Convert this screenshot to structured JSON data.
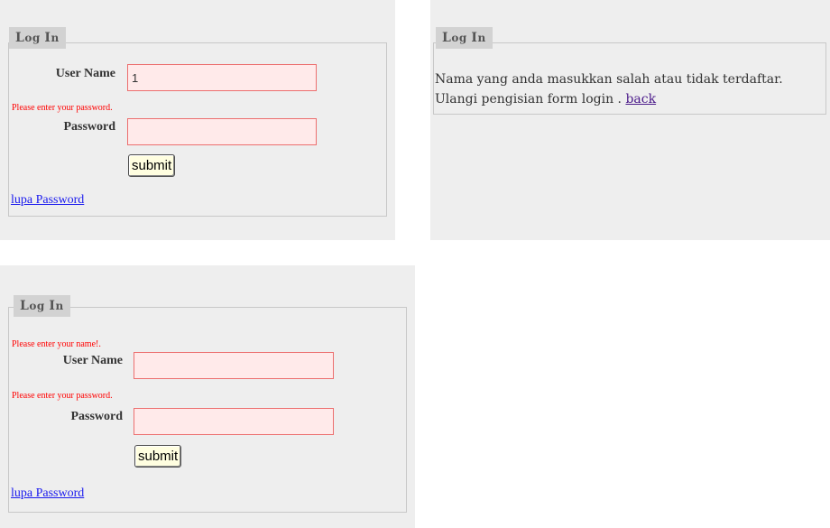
{
  "legend": {
    "first_a": "L",
    "rest_a": "og ",
    "first_b": "I",
    "rest_b": "n"
  },
  "panel_top_left": {
    "username_label": "User Name",
    "username_value": "1",
    "password_error": "Please enter your password.",
    "password_label": "Password",
    "password_value": "",
    "submit_label": "submit",
    "forgot_link": "lupa Password"
  },
  "panel_top_right": {
    "message_line1": "Nama yang anda masukkan salah atau tidak terdaftar.",
    "message_line2": "Ulangi pengisian form login . ",
    "back_link": "back"
  },
  "panel_bottom": {
    "username_error": "Please enter your name!.",
    "username_label": "User Name",
    "username_value": "",
    "password_error": "Please enter your password.",
    "password_label": "Password",
    "password_value": "",
    "submit_label": "submit",
    "forgot_link": "lupa Password"
  },
  "colors": {
    "panel_bg": "#eeeeee",
    "legend_bg": "#d2d2d2",
    "input_bg": "#ffeaea",
    "input_border": "#ec6f6f",
    "error_text": "#ff0000",
    "link": "#1a1aee",
    "button_bg": "#fffee0"
  }
}
